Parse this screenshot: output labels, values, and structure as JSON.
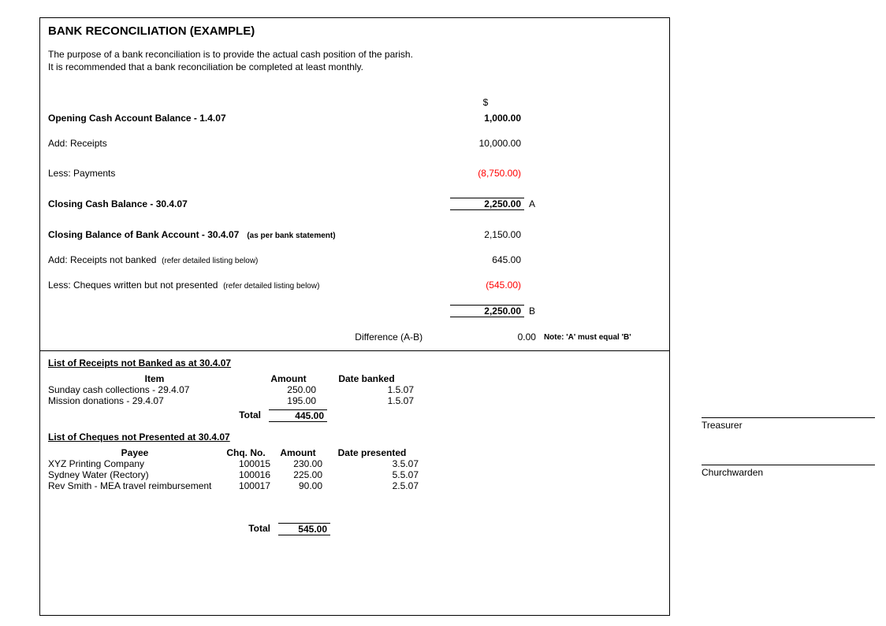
{
  "title": "BANK RECONCILIATION (EXAMPLE)",
  "purpose_line1": "The purpose of a bank reconciliation is to provide the actual cash position of the parish.",
  "purpose_line2": "It is recommended that a bank reconciliation be completed at least monthly.",
  "currency_header": "$",
  "rows": {
    "opening_label": "Opening Cash Account Balance - 1.4.07",
    "opening_value": "1,000.00",
    "add_receipts_label": "Add: Receipts",
    "add_receipts_value": "10,000.00",
    "less_payments_label": "Less: Payments",
    "less_payments_value": "(8,750.00)",
    "closing_cash_label": "Closing Cash Balance - 30.4.07",
    "closing_cash_value": "2,250.00",
    "closing_cash_letter": "A",
    "bank_closing_label": "Closing Balance of Bank Account  - 30.4.07",
    "bank_closing_sub": "(as per bank statement)",
    "bank_closing_value": "2,150.00",
    "add_notbanked_label": "Add: Receipts not banked",
    "add_notbanked_sub": "(refer detailed listing below)",
    "add_notbanked_value": "645.00",
    "less_cheques_label": "Less: Cheques written but not presented",
    "less_cheques_sub": "(refer detailed listing below)",
    "less_cheques_value": "(545.00)",
    "bank_total_value": "2,250.00",
    "bank_total_letter": "B",
    "difference_label": "Difference (A-B)",
    "difference_value": "0.00",
    "difference_note": "Note: 'A' must equal 'B'"
  },
  "receipts": {
    "title": "List of Receipts not Banked as at 30.4.07",
    "headers": {
      "item": "Item",
      "amount": "Amount",
      "date": "Date banked"
    },
    "items": [
      {
        "item": "Sunday cash collections - 29.4.07",
        "amount": "250.00",
        "date": "1.5.07"
      },
      {
        "item": "Mission donations - 29.4.07",
        "amount": "195.00",
        "date": "1.5.07"
      }
    ],
    "total_label": "Total",
    "total_value": "445.00"
  },
  "cheques": {
    "title": "List of Cheques not Presented at 30.4.07",
    "headers": {
      "payee": "Payee",
      "no": "Chq. No.",
      "amount": "Amount",
      "date": "Date presented"
    },
    "items": [
      {
        "payee": "XYZ Printing Company",
        "no": "100015",
        "amount": "230.00",
        "date": "3.5.07"
      },
      {
        "payee": "Sydney Water (Rectory)",
        "no": "100016",
        "amount": "225.00",
        "date": "5.5.07"
      },
      {
        "payee": "Rev Smith - MEA travel reimbursement",
        "no": "100017",
        "amount": "90.00",
        "date": "2.5.07"
      }
    ],
    "total_label": "Total",
    "total_value": "545.00"
  },
  "signatures": {
    "treasurer": "Treasurer",
    "churchwarden": "Churchwarden"
  }
}
